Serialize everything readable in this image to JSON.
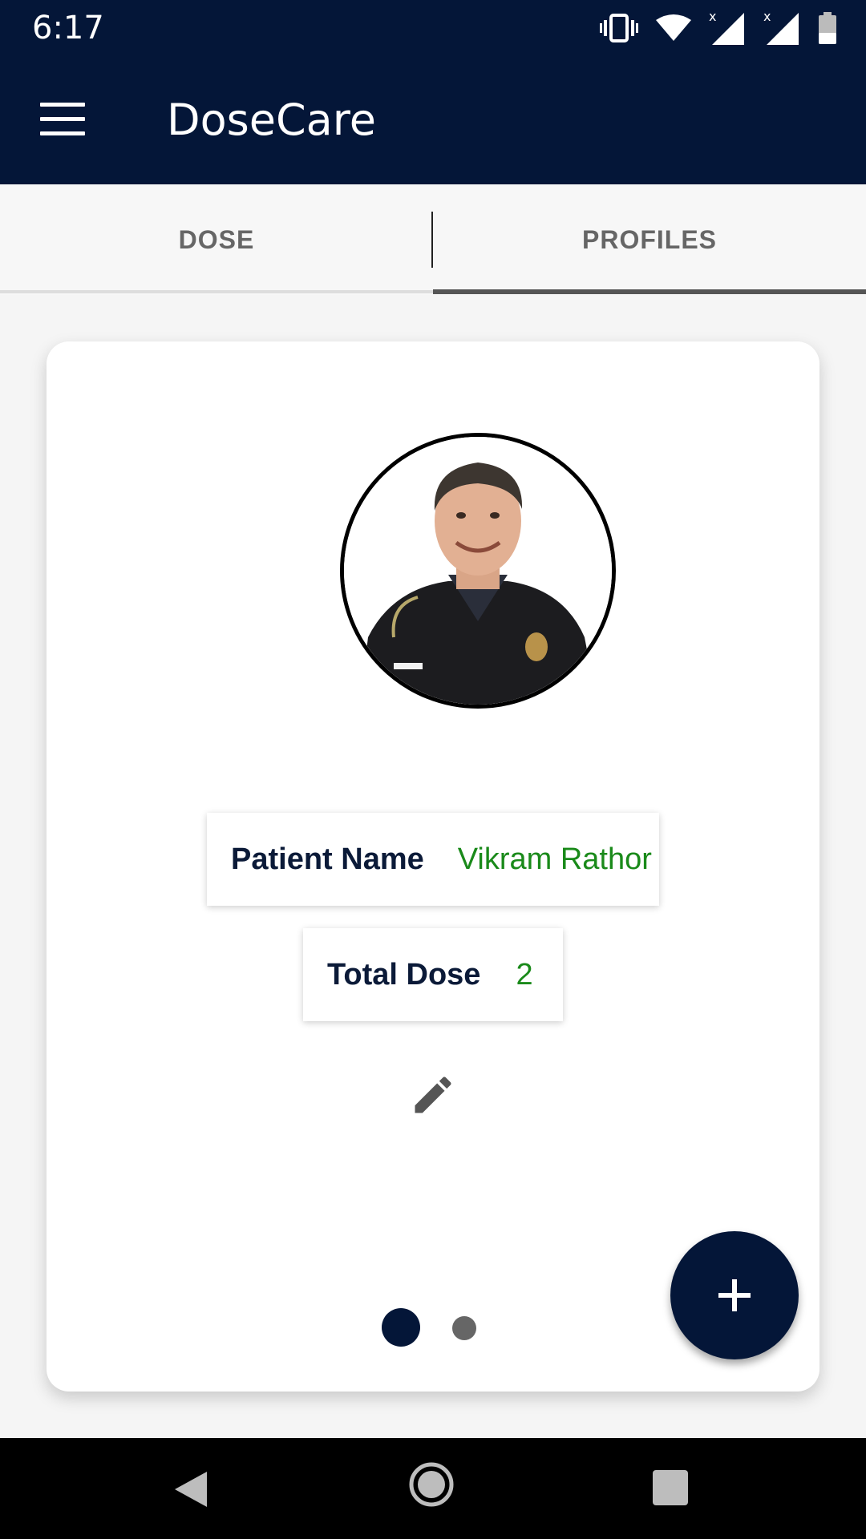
{
  "status_bar": {
    "time": "6:17",
    "icons": [
      "vibrate-icon",
      "wifi-icon",
      "signal-icon",
      "signal-icon",
      "battery-icon"
    ]
  },
  "app_bar": {
    "title": "DoseCare",
    "menu_icon": "hamburger-menu-icon"
  },
  "tabs": {
    "items": [
      {
        "label": "DOSE",
        "selected": false
      },
      {
        "label": "PROFILES",
        "selected": true
      }
    ]
  },
  "profile": {
    "patient_name_label": "Patient Name",
    "patient_name_value": "Vikram Rathor",
    "total_dose_label": "Total Dose",
    "total_dose_value": "2",
    "edit_icon": "pencil-icon"
  },
  "pager": {
    "page_count": 2,
    "current_page": 1
  },
  "fab": {
    "icon": "plus-icon"
  },
  "nav_bar": {
    "icons": [
      "back-icon",
      "home-icon",
      "recents-icon"
    ]
  },
  "colors": {
    "primary": "#041638",
    "value_text": "#1a8a1a",
    "label_text": "#0b1a38"
  }
}
